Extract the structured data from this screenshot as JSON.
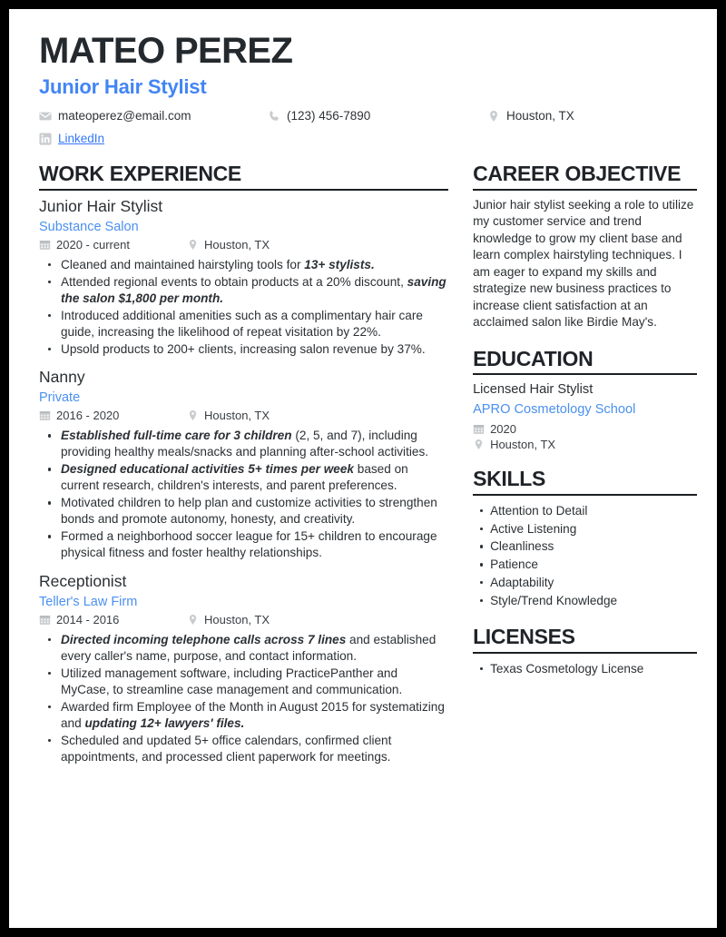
{
  "header": {
    "name": "MATEO PEREZ",
    "role": "Junior Hair Stylist",
    "role_color": "#4285f4",
    "contacts": {
      "email": "mateoperez@email.com",
      "phone": "(123) 456-7890",
      "location": "Houston, TX",
      "linkedin_label": "LinkedIn"
    }
  },
  "left": {
    "work": {
      "title": "WORK EXPERIENCE",
      "jobs": [
        {
          "title": "Junior Hair Stylist",
          "company": "Substance Salon",
          "dates": "2020 - current",
          "location": "Houston, TX",
          "bullets": [
            {
              "parts": [
                {
                  "t": "Cleaned and maintained hairstyling tools for  ",
                  "s": "n"
                },
                {
                  "t": "13+ stylists.",
                  "s": "bi"
                }
              ]
            },
            {
              "parts": [
                {
                  "t": "Attended regional events to obtain products at a 20% discount, ",
                  "s": "n"
                },
                {
                  "t": "saving the salon $1,800 per month.",
                  "s": "bi"
                }
              ]
            },
            {
              "parts": [
                {
                  "t": "Introduced additional amenities such as a complimentary hair care guide, increasing the likelihood of repeat visitation by 22%.",
                  "s": "n"
                }
              ]
            },
            {
              "parts": [
                {
                  "t": "Upsold products to 200+ clients, increasing salon revenue by 37%.",
                  "s": "n"
                }
              ]
            }
          ]
        },
        {
          "title": "Nanny",
          "company": "Private",
          "dates": "2016 - 2020",
          "location": "Houston, TX",
          "bullets": [
            {
              "parts": [
                {
                  "t": "Established full-time care for 3 children",
                  "s": "bi"
                },
                {
                  "t": " (2, 5, and 7), including providing healthy meals/snacks and planning after-school activities.",
                  "s": "n"
                }
              ]
            },
            {
              "parts": [
                {
                  "t": "Designed educational activities 5+ times per week",
                  "s": "bi"
                },
                {
                  "t": " based on current research, children's interests, and parent preferences.",
                  "s": "n"
                }
              ]
            },
            {
              "parts": [
                {
                  "t": "Motivated children to help plan and customize activities to strengthen bonds and promote autonomy, honesty, and creativity.",
                  "s": "n"
                }
              ]
            },
            {
              "parts": [
                {
                  "t": "Formed a neighborhood soccer league for 15+ children to encourage physical fitness and foster healthy relationships.",
                  "s": "n"
                }
              ]
            }
          ]
        },
        {
          "title": "Receptionist",
          "company": "Teller's Law Firm",
          "dates": "2014 - 2016",
          "location": "Houston, TX",
          "bullets": [
            {
              "parts": [
                {
                  "t": "Directed incoming telephone calls across 7 lines",
                  "s": "bi"
                },
                {
                  "t": " and established every caller's name, purpose, and contact information.",
                  "s": "n"
                }
              ]
            },
            {
              "parts": [
                {
                  "t": "Utilized management software, including PracticePanther and MyCase, to streamline case management and communication.",
                  "s": "n"
                }
              ]
            },
            {
              "parts": [
                {
                  "t": "Awarded firm Employee of the Month in August 2015 for systematizing and ",
                  "s": "n"
                },
                {
                  "t": "updating 12+ lawyers' files.",
                  "s": "bi"
                }
              ]
            },
            {
              "parts": [
                {
                  "t": "Scheduled and updated 5+ office calendars, confirmed client appointments, and processed client paperwork for meetings.",
                  "s": "n"
                }
              ]
            }
          ]
        }
      ]
    }
  },
  "right": {
    "objective": {
      "title": "CAREER OBJECTIVE",
      "text": "Junior hair stylist seeking a role to utilize my customer service and trend knowledge to grow my client base and learn complex hairstyling techniques. I am eager to expand my skills and strategize new business practices to increase client satisfaction at an acclaimed salon like Birdie May's."
    },
    "education": {
      "title": "EDUCATION",
      "degree": "Licensed Hair Stylist",
      "school": "APRO Cosmetology School",
      "year": "2020",
      "location": "Houston, TX"
    },
    "skills": {
      "title": "SKILLS",
      "items": [
        "Attention to Detail",
        "Active Listening",
        "Cleanliness",
        "Patience",
        "Adaptability",
        "Style/Trend Knowledge"
      ]
    },
    "licenses": {
      "title": "LICENSES",
      "items": [
        "Texas Cosmetology License"
      ]
    }
  },
  "icons": {
    "email": "envelope-icon",
    "phone": "phone-icon",
    "location": "map-pin-icon",
    "linkedin": "linkedin-icon",
    "calendar": "calendar-icon"
  },
  "colors": {
    "accent": "#4285f4",
    "link": "#3478f6",
    "text": "#2b3034",
    "rule": "#1b1f23",
    "frame": "#000000"
  }
}
